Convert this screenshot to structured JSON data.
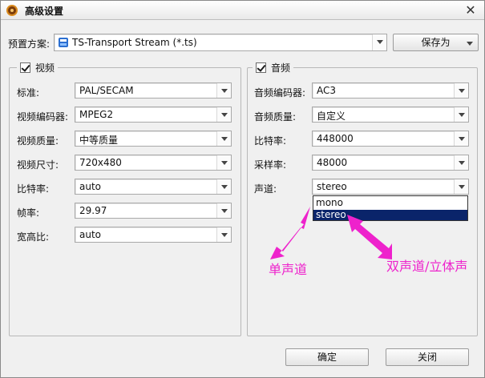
{
  "window": {
    "title": "高级设置",
    "app_icon": "film-reel-icon"
  },
  "preset": {
    "label": "预置方案:",
    "value": "TS-Transport Stream (*.ts)",
    "icon": "video-file-icon"
  },
  "save_as": {
    "label": "保存为"
  },
  "video": {
    "group_label": "视频",
    "enabled": true,
    "fields": [
      {
        "label": "标准:",
        "value": "PAL/SECAM"
      },
      {
        "label": "视频编码器:",
        "value": "MPEG2"
      },
      {
        "label": "视频质量:",
        "value": "中等质量"
      },
      {
        "label": "视频尺寸:",
        "value": "720x480"
      },
      {
        "label": "比特率:",
        "value": "auto"
      },
      {
        "label": "帧率:",
        "value": "29.97"
      },
      {
        "label": "宽高比:",
        "value": "auto"
      }
    ]
  },
  "audio": {
    "group_label": "音频",
    "enabled": true,
    "fields": [
      {
        "label": "音频编码器:",
        "value": "AC3"
      },
      {
        "label": "音频质量:",
        "value": "自定义"
      },
      {
        "label": "比特率:",
        "value": "448000"
      },
      {
        "label": "采样率:",
        "value": "48000"
      },
      {
        "label": "声道:",
        "value": "stereo"
      }
    ],
    "channel_options": [
      "mono",
      "stereo"
    ],
    "channel_selected": "stereo"
  },
  "annotations": {
    "mono": "单声道",
    "stereo": "双声道/立体声",
    "color": "#ee22cc"
  },
  "buttons": {
    "ok": "确定",
    "close": "关闭"
  }
}
